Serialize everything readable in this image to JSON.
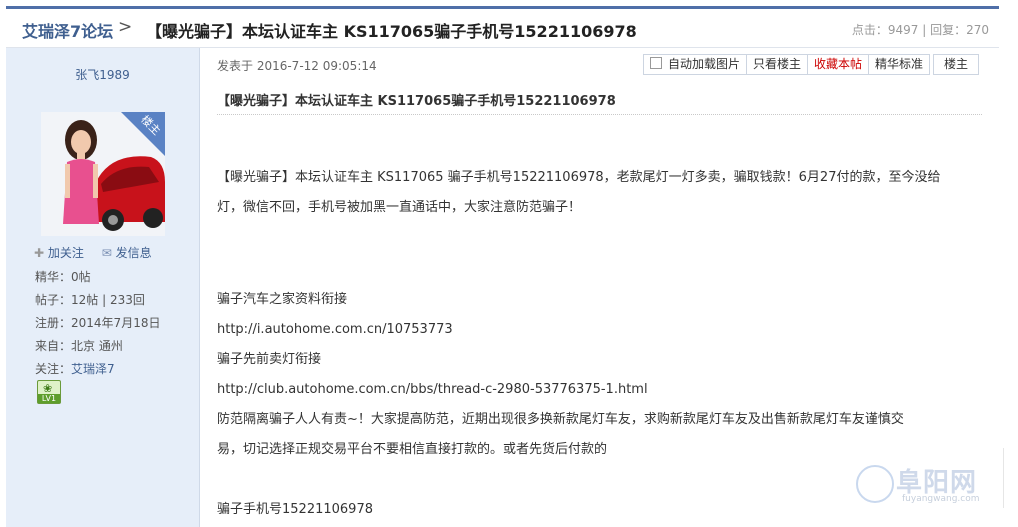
{
  "header": {
    "forum_name": "艾瑞泽7论坛",
    "separator": ">",
    "thread_title": "【曝光骗子】本坛认证车主 KS117065骗子手机号15221106978",
    "views_label": "点击：",
    "views": "9497",
    "divider": "|",
    "replies_label": "回复：",
    "replies": "270"
  },
  "author": {
    "username": "张飞1989",
    "badge": "楼主",
    "follow_label": "加关注",
    "message_label": "发信息",
    "stats": [
      {
        "label": "精华：",
        "value": "0帖"
      },
      {
        "label": "帖子：",
        "value": "12帖 | 233回"
      },
      {
        "label": "注册：",
        "value": "2014年7月18日"
      },
      {
        "label": "来自：",
        "value": "北京 通州"
      },
      {
        "label": "关注：",
        "value": "艾瑞泽7"
      }
    ],
    "level": "LV1"
  },
  "post": {
    "posted_at": "发表于 2016-7-12 09:05:14",
    "toolbar": {
      "autoload_images": "自动加载图片",
      "only_op": "只看楼主",
      "favorite": "收藏本帖",
      "fine_standard": "精华标准",
      "floor": "楼主"
    },
    "subtitle": "【曝光骗子】本坛认证车主 KS117065骗子手机号15221106978",
    "paragraph1_line1": "【曝光骗子】本坛认证车主 KS117065 骗子手机号15221106978，老款尾灯一灯多卖，骗取钱款！6月27付的款，至今没给",
    "paragraph1_line2": "灯，微信不回，手机号被加黑一直通话中，大家注意防范骗子！",
    "label_info": "骗子汽车之家资料衔接",
    "link_info": "http://i.autohome.com.cn/10753773",
    "label_sell": "骗子先前卖灯衔接",
    "link_sell": "http://club.autohome.com.cn/bbs/thread-c-2980-53776375-1.html",
    "warning_line1": "防范隔离骗子人人有责~！大家提高防范，近期出现很多换新款尾灯车友，求购新款尾灯车友及出售新款尾灯车友谨慎交",
    "warning_line2": "易，切记选择正规交易平台不要相信直接打款的。或者先货后付款的",
    "phone_line": "骗子手机号15221106978"
  },
  "watermark": {
    "brand": "阜阳网",
    "domain": "fuyangwang.com"
  },
  "colors": {
    "accent": "#3f5f8f",
    "sidebar_bg": "#e6eef9",
    "favorite_red": "#cc0000"
  }
}
